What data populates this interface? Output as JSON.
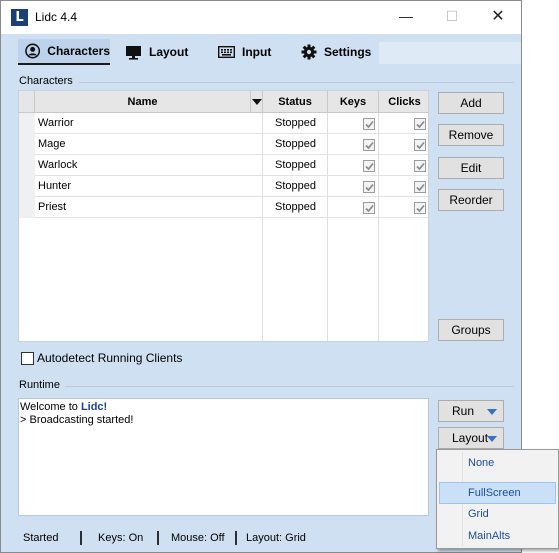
{
  "window": {
    "app_icon_letter": "L",
    "title": "Lidc 4.4",
    "min": "—",
    "max": "☐",
    "close": "✕"
  },
  "tabs": [
    {
      "label": "Characters",
      "icon": "user-circle-icon"
    },
    {
      "label": "Layout",
      "icon": "monitor-icon"
    },
    {
      "label": "Input",
      "icon": "keyboard-icon"
    },
    {
      "label": "Settings",
      "icon": "gear-icon"
    }
  ],
  "characters": {
    "group_label": "Characters",
    "columns": {
      "name": "Name",
      "status": "Status",
      "keys": "Keys",
      "clicks": "Clicks"
    },
    "rows": [
      {
        "name": "Warrior",
        "status": "Stopped",
        "keys": true,
        "clicks": true
      },
      {
        "name": "Mage",
        "status": "Stopped",
        "keys": true,
        "clicks": true
      },
      {
        "name": "Warlock",
        "status": "Stopped",
        "keys": true,
        "clicks": true
      },
      {
        "name": "Hunter",
        "status": "Stopped",
        "keys": true,
        "clicks": true
      },
      {
        "name": "Priest",
        "status": "Stopped",
        "keys": true,
        "clicks": true
      }
    ],
    "buttons": {
      "add": "Add",
      "remove": "Remove",
      "edit": "Edit",
      "reorder": "Reorder",
      "groups": "Groups"
    },
    "autodetect_label": "Autodetect Running Clients"
  },
  "runtime": {
    "group_label": "Runtime",
    "console_prefix": "Welcome to ",
    "console_brand": "Lidc!",
    "console_line2": "> Broadcasting started!",
    "run_label": "Run",
    "layout_label": "Layout"
  },
  "layout_menu": {
    "items": [
      "None",
      "FullScreen",
      "Grid",
      "MainAlts"
    ],
    "highlighted": "FullScreen"
  },
  "statusbar": {
    "started": "Started",
    "keys": "Keys: On",
    "mouse": "Mouse: Off",
    "layout": "Layout: Grid"
  },
  "colors": {
    "window_bg": "#cfe0f3",
    "accent": "#1d3f78",
    "menu_text": "#1a4fa0",
    "menu_highlight": "#c9e0f7"
  }
}
